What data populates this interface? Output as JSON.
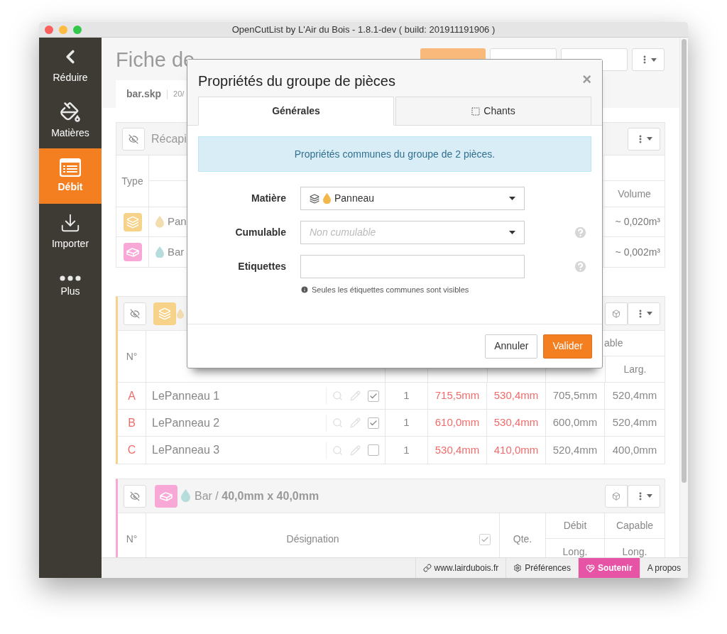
{
  "window": {
    "title": "OpenCutList by L'Air du Bois - 1.8.1-dev ( build: 201911191906 )"
  },
  "sidebar": {
    "items": [
      {
        "label": "Réduire",
        "selected": false
      },
      {
        "label": "Matières",
        "selected": false
      },
      {
        "label": "Débit",
        "selected": true
      },
      {
        "label": "Importer",
        "selected": false
      },
      {
        "label": "Plus",
        "selected": false
      }
    ]
  },
  "page": {
    "title": "Fiche de",
    "toolbar": [
      {
        "kind": "primary"
      },
      {
        "kind": "default"
      },
      {
        "kind": "default"
      },
      {
        "kind": "menu"
      }
    ],
    "file_tab": {
      "name": "bar.skp",
      "date": "20/"
    }
  },
  "summary": {
    "title": "Récapi",
    "type_header": "Type",
    "volume_header": "Volume",
    "rows": [
      {
        "color": "#f7d38a",
        "material": {
          "name": "Pan",
          "color": "#f3dcae"
        },
        "volume": "~ 0,020m³"
      },
      {
        "color": "#f7a8d6",
        "material": {
          "name": "Bar",
          "color": "#b7dcdc"
        },
        "volume": "~ 0,002m³"
      }
    ]
  },
  "panel_group": {
    "color": "#f7d38a",
    "material": {
      "color": "#f3dcae"
    },
    "headers": {
      "number": "N°",
      "capable": "able",
      "capable_width": "Larg."
    },
    "rows": [
      {
        "id": "A",
        "name": "LePanneau 1",
        "checked": true,
        "qty": "1",
        "cut_length": "715,5mm",
        "cut_width": "530,4mm",
        "length": "705,5mm",
        "width": "520,4mm"
      },
      {
        "id": "B",
        "name": "LePanneau 2",
        "checked": true,
        "qty": "1",
        "cut_length": "610,0mm",
        "cut_width": "530,4mm",
        "length": "600,0mm",
        "width": "520,4mm"
      },
      {
        "id": "C",
        "name": "LePanneau 3",
        "checked": false,
        "qty": "1",
        "cut_length": "530,4mm",
        "cut_width": "410,0mm",
        "length": "520,4mm",
        "width": "400,0mm"
      }
    ]
  },
  "bar_group": {
    "color": "#f7a8d6",
    "material": {
      "color": "#b7dcdc"
    },
    "title": "Bar / **40,0mm x 40,0mm**",
    "all_checked": true,
    "headers": {
      "number": "N°",
      "name": "Désignation",
      "qty": "Qte.",
      "cut": "Débit",
      "capable": "Capable",
      "cut_length": "Long.",
      "length": "Long."
    }
  },
  "dialog": {
    "title": "Propriétés du groupe de pièces",
    "close": "×",
    "tabs": [
      {
        "label": "Générales",
        "selected": true
      },
      {
        "label": "Chants",
        "selected": false
      }
    ],
    "alert": "Propriétés communes du groupe de 2 pièces.",
    "fields": [
      {
        "label": "Matière",
        "kind": "select",
        "value": "Panneau",
        "material": {
          "color": "#f2b84b"
        },
        "help": false
      },
      {
        "label": "Cumulable",
        "kind": "select",
        "placeholder": "Non cumulable",
        "help": true
      },
      {
        "label": "Etiquettes",
        "kind": "text",
        "help": true,
        "note": "Seules les étiquettes communes sont visibles"
      }
    ],
    "buttons": [
      {
        "label": "Annuler",
        "kind": "secondary"
      },
      {
        "label": "Valider",
        "kind": "primary"
      }
    ]
  },
  "footer": {
    "items": [
      {
        "label": "www.lairdubois.fr",
        "kind": "link"
      },
      {
        "label": "Préférences",
        "kind": "settings"
      },
      {
        "label": "Soutenir",
        "kind": "support"
      },
      {
        "label": "A propos",
        "kind": "plain"
      }
    ]
  }
}
